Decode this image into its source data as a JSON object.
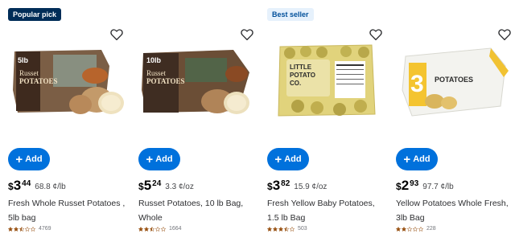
{
  "colors": {
    "accent": "#0071dc",
    "star": "#995213"
  },
  "products": [
    {
      "badge": "Popular pick",
      "badge_style": "dark",
      "add_label": "Add",
      "price_currency": "$",
      "price_dollars": "3",
      "price_cents": "44",
      "unit_price": "68.8 ¢/lb",
      "name": "Fresh Whole Russet Potatoes , 5lb bag",
      "rating": 2.5,
      "review_count": "4769",
      "image_text": [
        "5lb",
        "Russet",
        "POTATOES"
      ]
    },
    {
      "badge": "",
      "badge_style": "",
      "add_label": "Add",
      "price_currency": "$",
      "price_dollars": "5",
      "price_cents": "24",
      "unit_price": "3.3 ¢/oz",
      "name": "Russet Potatoes, 10 lb Bag, Whole",
      "rating": 2.5,
      "review_count": "1664",
      "image_text": [
        "10lb",
        "Russet",
        "POTATOES"
      ]
    },
    {
      "badge": "Best seller",
      "badge_style": "light",
      "add_label": "Add",
      "price_currency": "$",
      "price_dollars": "3",
      "price_cents": "82",
      "unit_price": "15.9 ¢/oz",
      "name": "Fresh Yellow Baby Potatoes, 1.5 lb Bag",
      "rating": 3.5,
      "review_count": "503",
      "image_text": [
        "LITTLE",
        "POTATO",
        "CO."
      ]
    },
    {
      "badge": "",
      "badge_style": "",
      "add_label": "Add",
      "price_currency": "$",
      "price_dollars": "2",
      "price_cents": "93",
      "unit_price": "97.7 ¢/lb",
      "name": "Yellow Potatoes Whole Fresh, 3lb Bag",
      "rating": 2,
      "review_count": "228",
      "image_text": [
        "3",
        "POTATOES"
      ]
    }
  ]
}
